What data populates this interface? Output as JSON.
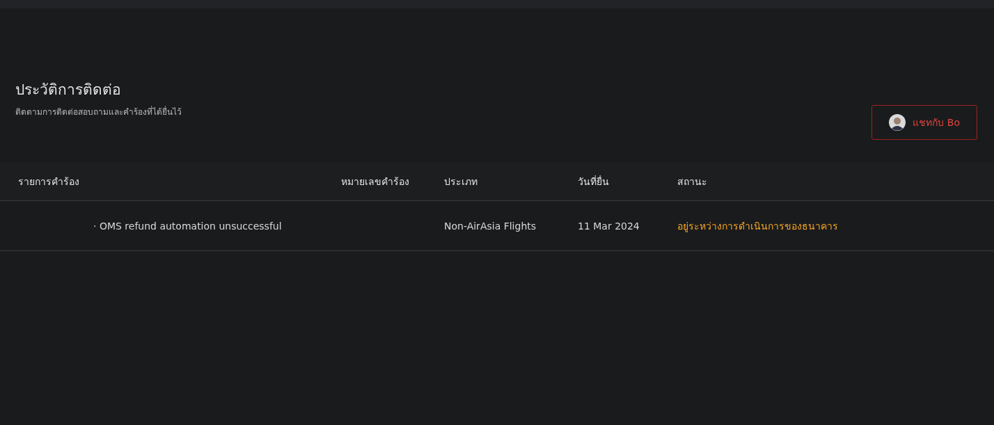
{
  "header": {
    "title": "ประวัติการติดต่อ",
    "subtitle": "ติดตามการติดต่อสอบถามและคำร้องที่ได้ยื่นไว้",
    "chat_button": "แชทกับ Bo"
  },
  "table": {
    "columns": [
      "รายการคำร้อง",
      "หมายเลขคำร้อง",
      "ประเภท",
      "วันที่ยื่น",
      "สถานะ"
    ],
    "rows": [
      {
        "cells": [
          "· OMS refund automation unsuccessful",
          "",
          "Non-AirAsia Flights",
          "11 Mar 2024",
          "อยู่ระหว่างการดำเนินการของธนาคาร"
        ]
      }
    ]
  }
}
